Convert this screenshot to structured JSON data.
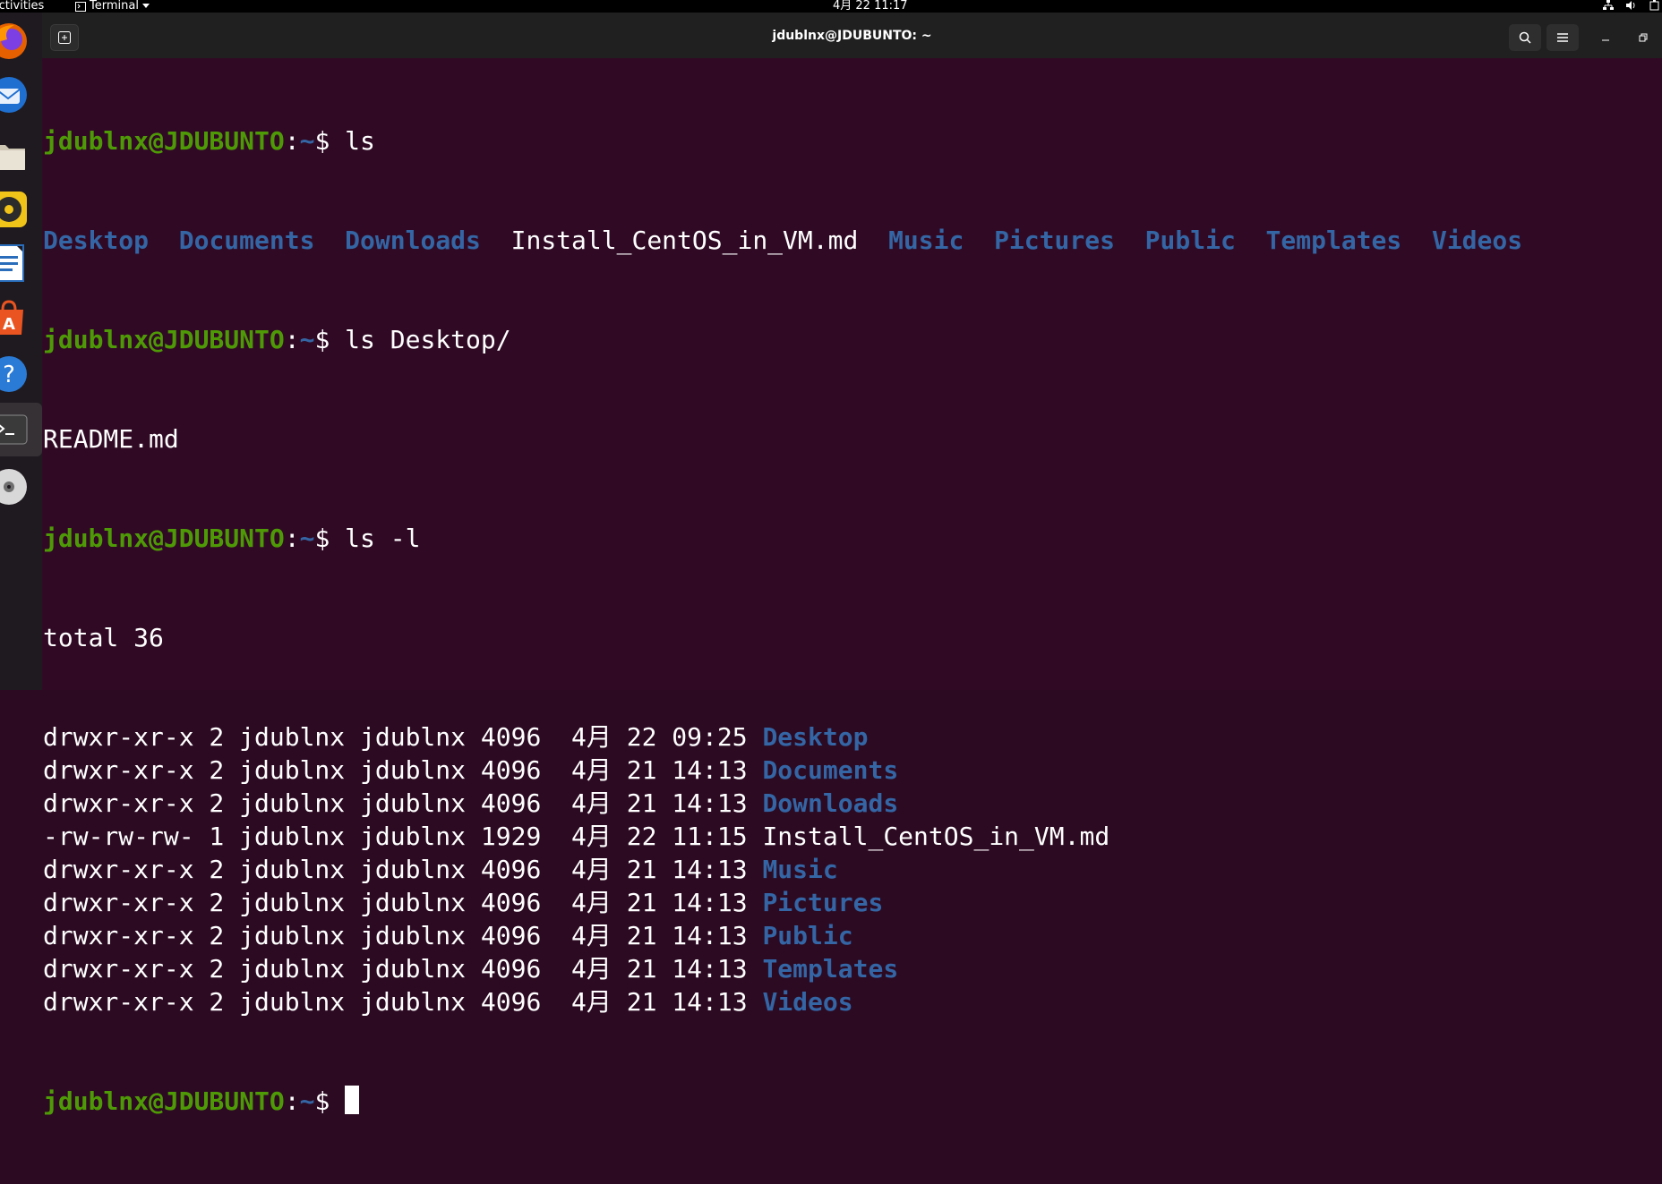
{
  "topbar": {
    "activities": "Activities",
    "app_menu": "Terminal",
    "clock": "4月 22  11:17"
  },
  "window": {
    "title": "jdublnx@JDUBUNTO: ~"
  },
  "prompt": {
    "user_host": "jdublnx@JDUBUNTO",
    "sep": ":",
    "path": "~",
    "symbol": "$ "
  },
  "terminal": {
    "cmd1": "ls",
    "ls_output": [
      {
        "name": "Desktop",
        "dir": true
      },
      {
        "name": "Documents",
        "dir": true
      },
      {
        "name": "Downloads",
        "dir": true
      },
      {
        "name": "Install_CentOS_in_VM.md",
        "dir": false
      },
      {
        "name": "Music",
        "dir": true
      },
      {
        "name": "Pictures",
        "dir": true
      },
      {
        "name": "Public",
        "dir": true
      },
      {
        "name": "Templates",
        "dir": true
      },
      {
        "name": "Videos",
        "dir": true
      }
    ],
    "cmd2": "ls Desktop/",
    "desktop_output": "README.md",
    "cmd3": "ls -l",
    "total": "total 36",
    "long_listing": [
      {
        "meta": "drwxr-xr-x 2 jdublnx jdublnx 4096  4月 22 09:25 ",
        "name": "Desktop",
        "dir": true
      },
      {
        "meta": "drwxr-xr-x 2 jdublnx jdublnx 4096  4月 21 14:13 ",
        "name": "Documents",
        "dir": true
      },
      {
        "meta": "drwxr-xr-x 2 jdublnx jdublnx 4096  4月 21 14:13 ",
        "name": "Downloads",
        "dir": true
      },
      {
        "meta": "-rw-rw-rw- 1 jdublnx jdublnx 1929  4月 22 11:15 ",
        "name": "Install_CentOS_in_VM.md",
        "dir": false
      },
      {
        "meta": "drwxr-xr-x 2 jdublnx jdublnx 4096  4月 21 14:13 ",
        "name": "Music",
        "dir": true
      },
      {
        "meta": "drwxr-xr-x 2 jdublnx jdublnx 4096  4月 21 14:13 ",
        "name": "Pictures",
        "dir": true
      },
      {
        "meta": "drwxr-xr-x 2 jdublnx jdublnx 4096  4月 21 14:13 ",
        "name": "Public",
        "dir": true
      },
      {
        "meta": "drwxr-xr-x 2 jdublnx jdublnx 4096  4月 21 14:13 ",
        "name": "Templates",
        "dir": true
      },
      {
        "meta": "drwxr-xr-x 2 jdublnx jdublnx 4096  4月 21 14:13 ",
        "name": "Videos",
        "dir": true
      }
    ]
  },
  "dock": [
    {
      "icon": "firefox-icon"
    },
    {
      "icon": "thunderbird-icon"
    },
    {
      "icon": "files-icon"
    },
    {
      "icon": "rhythmbox-icon"
    },
    {
      "icon": "libreoffice-writer-icon"
    },
    {
      "icon": "app-center-icon"
    },
    {
      "icon": "help-icon"
    },
    {
      "icon": "terminal-icon"
    },
    {
      "icon": "dvd-icon"
    }
  ],
  "colors": {
    "background": "#300a24",
    "prompt_user": "#4e9a06",
    "directory": "#3465a4",
    "text": "#ffffff"
  }
}
